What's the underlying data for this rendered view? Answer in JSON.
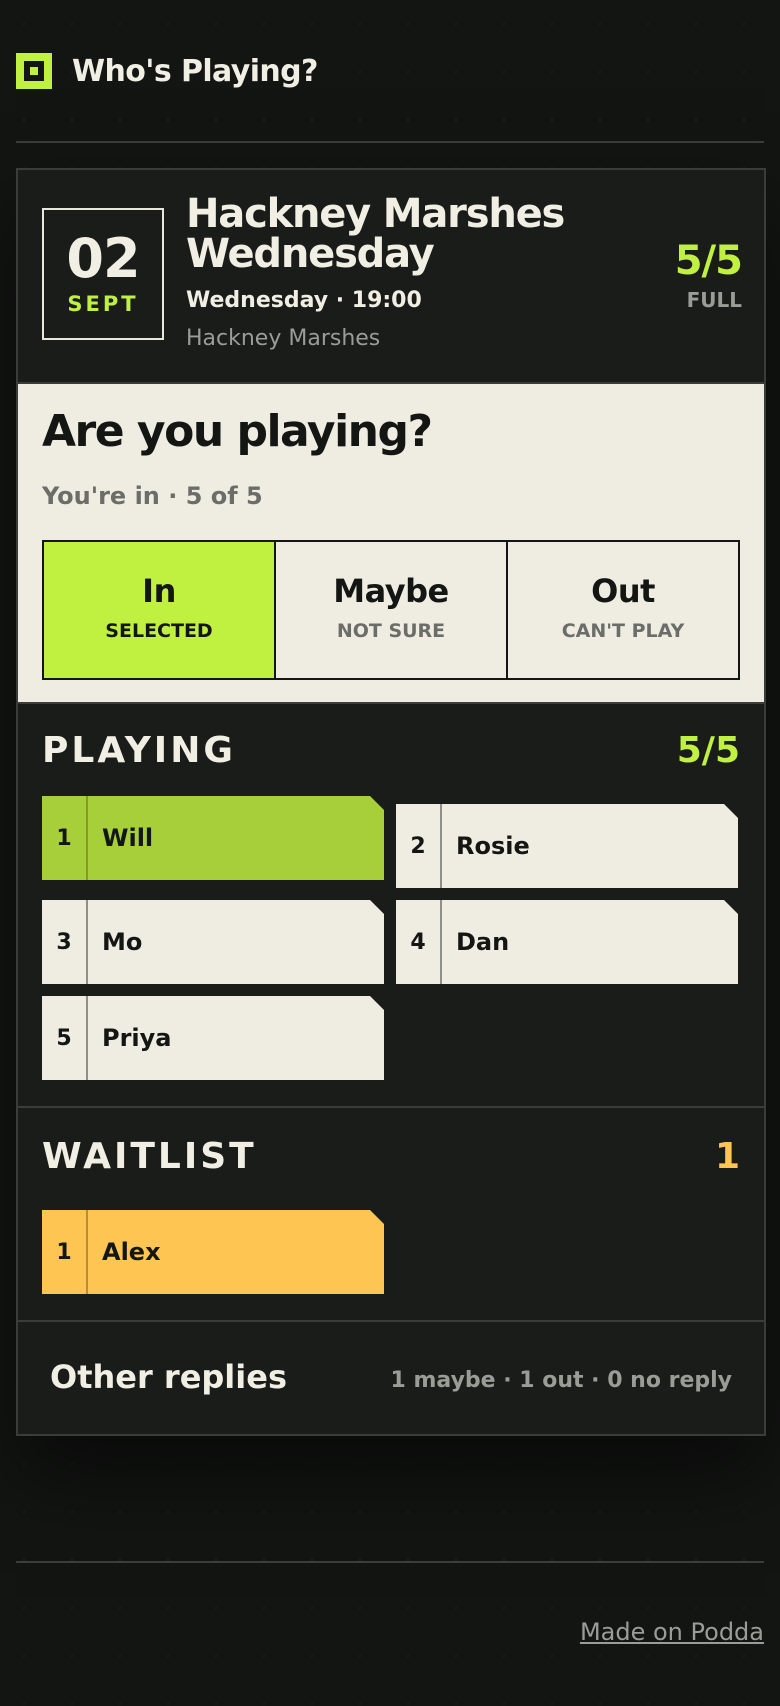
{
  "app": {
    "title": "Who's Playing?",
    "logo_icon": "square-logo-icon"
  },
  "event": {
    "day": "02",
    "month": "SEPT",
    "title": "Hackney Marshes Wednesday",
    "when": "Wednesday · 19:00",
    "where": "Hackney Marshes",
    "count": "5/5",
    "count_label": "FULL"
  },
  "rsvp": {
    "question": "Are you playing?",
    "status": "You're in · 5 of 5",
    "choices": [
      {
        "label": "In",
        "sub": "SELECTED",
        "selected": true
      },
      {
        "label": "Maybe",
        "sub": "NOT SURE",
        "selected": false
      },
      {
        "label": "Out",
        "sub": "CAN'T PLAY",
        "selected": false
      }
    ]
  },
  "playing": {
    "title": "PLAYING",
    "count": "5/5",
    "players": [
      {
        "num": "1",
        "name": "Will"
      },
      {
        "num": "2",
        "name": "Rosie"
      },
      {
        "num": "3",
        "name": "Mo"
      },
      {
        "num": "4",
        "name": "Dan"
      },
      {
        "num": "5",
        "name": "Priya"
      }
    ]
  },
  "waitlist": {
    "title": "WAITLIST",
    "count": "1",
    "players": [
      {
        "num": "1",
        "name": "Alex"
      }
    ]
  },
  "other": {
    "label": "Other replies",
    "summary": "1 maybe · 1 out · 0 no reply"
  },
  "footer": {
    "link": "Made on Podda"
  },
  "colors": {
    "accent": "#c0f141",
    "me": "#a6cf3a",
    "waitlist": "#ffc552",
    "background": "#131513",
    "card": "#1a1c1a",
    "panel": "#efece2"
  }
}
